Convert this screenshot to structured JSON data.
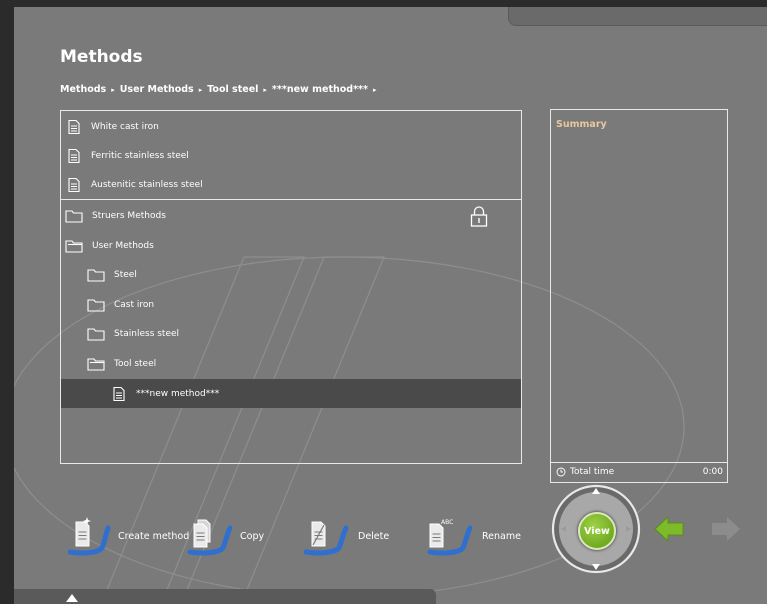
{
  "page": {
    "title": "Methods"
  },
  "breadcrumb": [
    "Methods",
    "User Methods",
    "Tool steel",
    "***new method***"
  ],
  "method_list": {
    "top_items": [
      {
        "label": "White cast iron",
        "icon": "document-icon"
      },
      {
        "label": "Ferritic stainless steel",
        "icon": "document-icon"
      },
      {
        "label": "Austenitic stainless steel",
        "icon": "document-icon"
      }
    ],
    "tree_items": [
      {
        "label": "Struers Methods",
        "icon": "folder-icon",
        "locked": true
      },
      {
        "label": "User Methods",
        "icon": "folder-open-icon"
      },
      {
        "label": "Steel",
        "icon": "folder-icon"
      },
      {
        "label": "Cast iron",
        "icon": "folder-icon"
      },
      {
        "label": "Stainless steel",
        "icon": "folder-icon"
      },
      {
        "label": "Tool steel",
        "icon": "folder-open-icon"
      },
      {
        "label": "***new method***",
        "icon": "document-icon",
        "selected": true
      }
    ]
  },
  "summary": {
    "title": "Summary",
    "total_time_label": "Total time",
    "total_time_value": "0:00"
  },
  "actions": {
    "create": "Create method",
    "copy": "Copy",
    "delete": "Delete",
    "rename": "Rename",
    "rename_icon_text": "ABC"
  },
  "nav": {
    "view_label": "View"
  },
  "colors": {
    "background": "#7a7a7a",
    "accent_green": "#7dbb2a",
    "summary_title": "#e8c89c",
    "selected_row": "#4a4a4a",
    "action_blue": "#2f6fd0"
  }
}
